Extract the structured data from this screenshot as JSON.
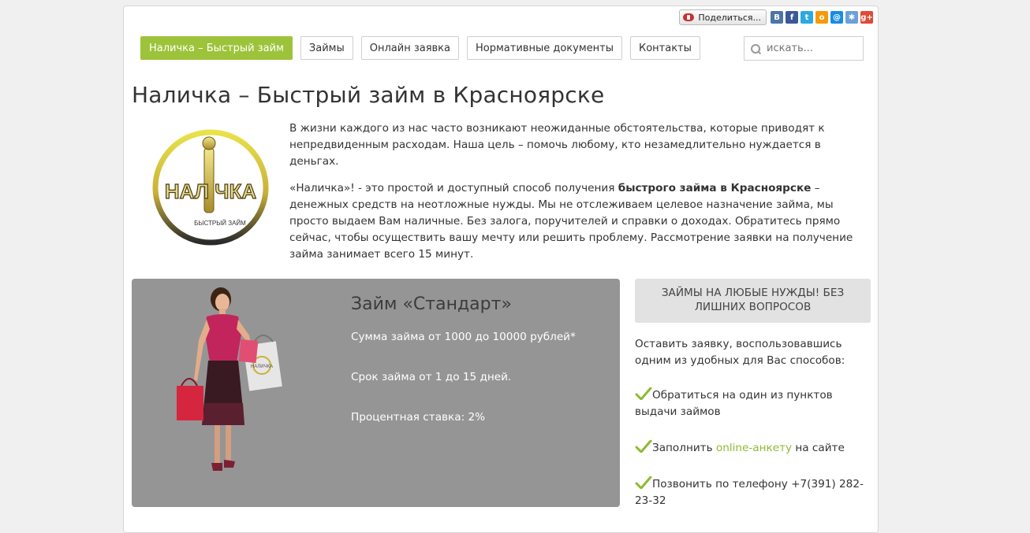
{
  "share": {
    "button_label": "Поделиться...",
    "networks": [
      {
        "name": "vk-icon",
        "glyph": "B",
        "color": "#4c75a3"
      },
      {
        "name": "facebook-icon",
        "glyph": "f",
        "color": "#3b5998"
      },
      {
        "name": "twitter-icon",
        "glyph": "t",
        "color": "#2ba9e1"
      },
      {
        "name": "odnoklassniki-icon",
        "glyph": "o",
        "color": "#f59a0c"
      },
      {
        "name": "mailru-icon",
        "glyph": "@",
        "color": "#168de2"
      },
      {
        "name": "liveinternet-icon",
        "glyph": "✱",
        "color": "#6ba1d6"
      },
      {
        "name": "googleplus-icon",
        "glyph": "g+",
        "color": "#dd4b39"
      }
    ]
  },
  "nav": {
    "items": [
      {
        "label": "Наличка – Быстрый займ",
        "active": true
      },
      {
        "label": "Займы",
        "active": false
      },
      {
        "label": "Онлайн заявка",
        "active": false
      },
      {
        "label": "Нормативные документы",
        "active": false
      },
      {
        "label": "Контакты",
        "active": false
      }
    ],
    "accent_color": "#9dc33a"
  },
  "search": {
    "placeholder": "искать..."
  },
  "page_title": "Наличка – Быстрый займ в Красноярске",
  "logo": {
    "main_text": "НАЛ ЧКА",
    "sub_text": "БЫСТРЫЙ ЗАЙМ"
  },
  "intro": {
    "p1": "В жизни каждого из нас часто возникают неожиданные обстоятельства, которые приводят к непредвиденным расходам. Наша цель – помочь любому, кто незамедлительно нуждается в деньгах.",
    "p2_start": "«Наличка»! - это простой и доступный способ получения ",
    "p2_bold": "быстрого займа в Красноярске",
    "p2_end": " –  денежных средств на неотложные нужды. Мы не отслеживаем целевое назначение займа, мы просто выдаем Вам наличные. Без залога, поручителей и справки о доходах. Обратитесь прямо сейчас, чтобы осуществить вашу мечту или решить проблему. Рассмотрение заявки на получение займа занимает всего 15 минут."
  },
  "promo": {
    "title": "Займ «Стандарт»",
    "amount": " Сумма займа от 1000 до 10000 рублей*",
    "term": "Срок займа от 1 до 15 дней.",
    "rate": "Процентная ставка: 2%",
    "bag_text": "НАЛИЧКА",
    "background": "#959595"
  },
  "side": {
    "heading": "ЗАЙМЫ НА ЛЮБЫЕ НУЖДЫ! БЕЗ ЛИШНИХ ВОПРОСОВ",
    "intro": "Оставить заявку, воспользовавшись одним из удобных для Вас способов:",
    "item1": "Обратиться на один из пунктов выдачи займов",
    "item2_start": "Заполнить ",
    "item2_link": "online-анкету",
    "item2_end": " на сайте",
    "item3": "Позвонить по телефону +7(391) 282-23-32",
    "check_color": "#8dbb32"
  }
}
